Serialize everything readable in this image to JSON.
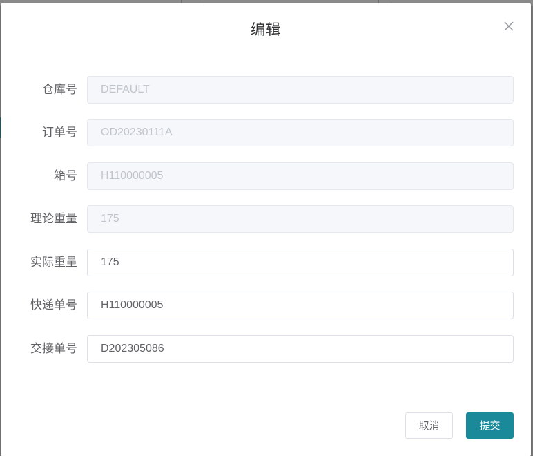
{
  "dialog": {
    "title": "编辑",
    "close_icon": "close-icon"
  },
  "form": {
    "fields": [
      {
        "label": "仓库号",
        "value": "DEFAULT",
        "disabled": true
      },
      {
        "label": "订单号",
        "value": "OD20230111A",
        "disabled": true
      },
      {
        "label": "箱号",
        "value": "H110000005",
        "disabled": true
      },
      {
        "label": "理论重量",
        "value": "175",
        "disabled": true
      },
      {
        "label": "实际重量",
        "value": "175",
        "disabled": false
      },
      {
        "label": "快递单号",
        "value": "H110000005",
        "disabled": false
      },
      {
        "label": "交接单号",
        "value": "D202305086",
        "disabled": false
      }
    ]
  },
  "footer": {
    "cancel_label": "取消",
    "submit_label": "提交"
  },
  "colors": {
    "accent": "#1a8a9a",
    "disabled_bg": "#f5f7fa",
    "border": "#dcdfe6"
  }
}
